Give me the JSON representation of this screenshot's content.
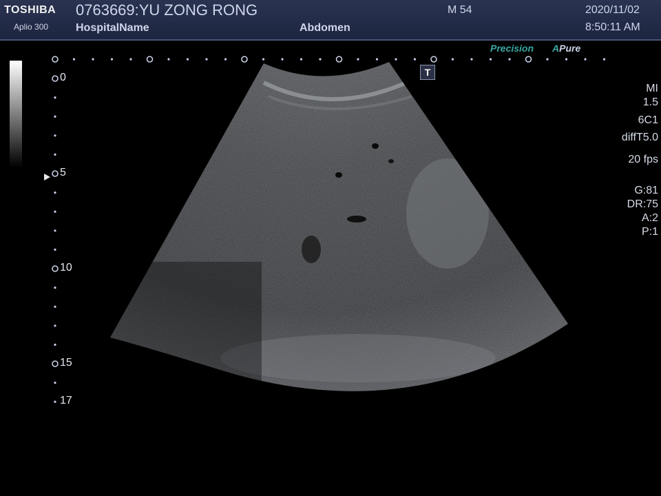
{
  "header": {
    "brand": "TOSHIBA",
    "model": "Aplio 300",
    "patient": "0763669:YU ZONG RONG",
    "hospital": "HospitalName",
    "exam": "Abdomen",
    "sex_age": "M 54",
    "date": "2020/11/02",
    "time": "8:50:11 AM"
  },
  "modes": {
    "precision": "Precision",
    "apure_a": "A",
    "apure_rest": "Pure"
  },
  "t_icon": "T",
  "params": {
    "mi_label": "MI",
    "mi_value": "1.5",
    "probe": "6C1",
    "preset": "diffT5.0",
    "fps": "20 fps",
    "gain": "G:81",
    "dr": "DR:75",
    "a": "A:2",
    "p": "P:1"
  },
  "depth_scale": {
    "labels": [
      "0",
      "5",
      "10",
      "15",
      "17"
    ],
    "max_cm": 17,
    "focus_cm": 6
  },
  "colors": {
    "header_bg": "#1d2540",
    "accent_teal": "#3aa8a5",
    "text": "#e6e9f2"
  }
}
